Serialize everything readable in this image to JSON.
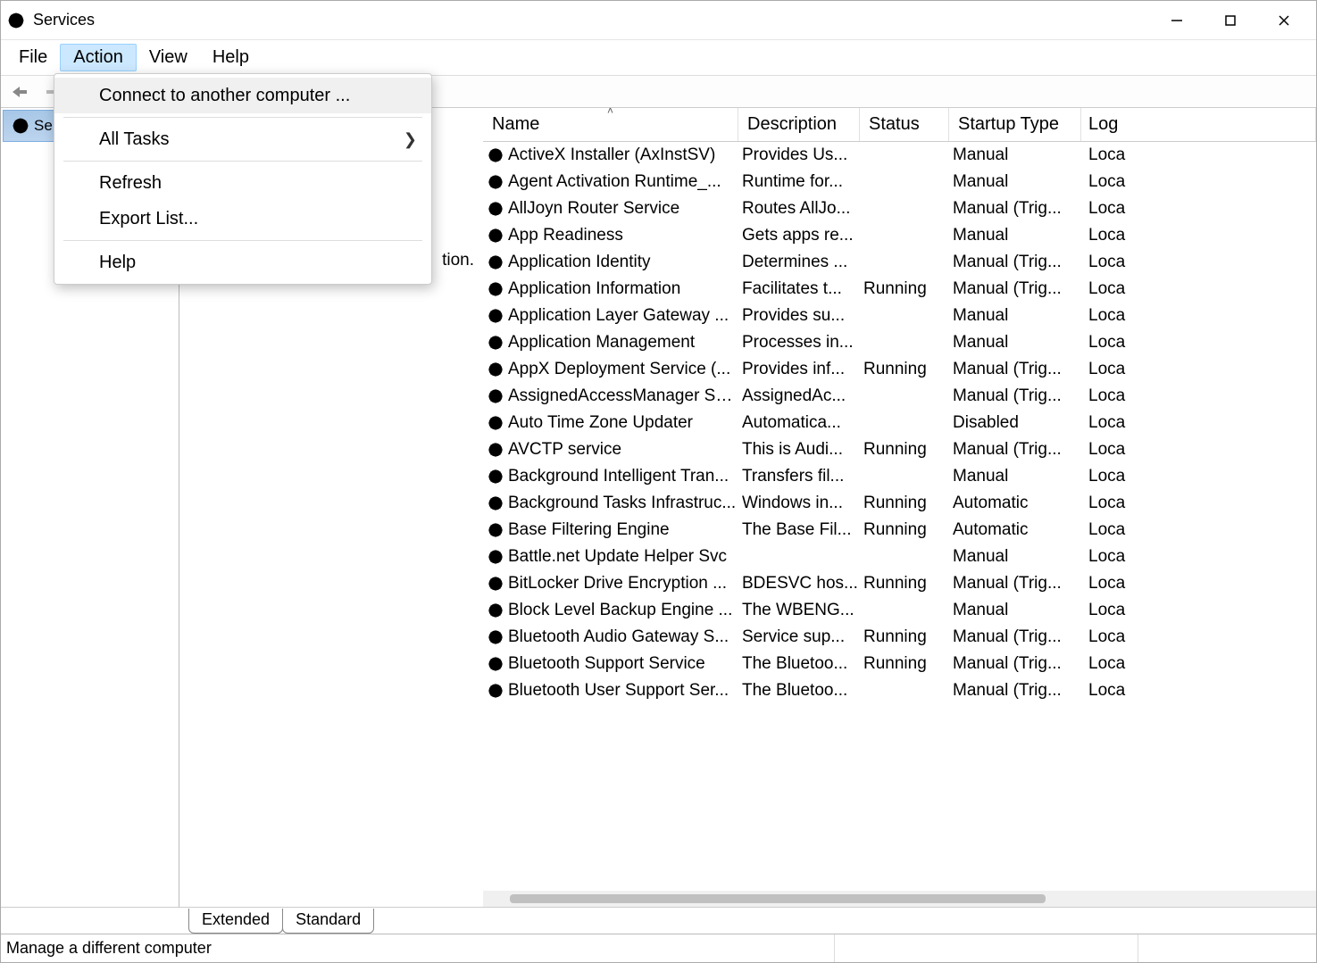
{
  "window": {
    "title": "Services"
  },
  "menubar": {
    "file": "File",
    "action": "Action",
    "view": "View",
    "help": "Help"
  },
  "dropdown": {
    "connect": "Connect to another computer ...",
    "all_tasks": "All Tasks",
    "refresh": "Refresh",
    "export_list": "Export List...",
    "help": "Help"
  },
  "tree": {
    "root_visible_fragment": "Se"
  },
  "detail": {
    "text_fragment": "tion."
  },
  "columns": {
    "name": "Name",
    "description": "Description",
    "status": "Status",
    "startup": "Startup Type",
    "logon": "Log"
  },
  "services": [
    {
      "name": "ActiveX Installer (AxInstSV)",
      "desc": "Provides Us...",
      "status": "",
      "startup": "Manual",
      "logon": "Loca"
    },
    {
      "name": "Agent Activation Runtime_...",
      "desc": "Runtime for...",
      "status": "",
      "startup": "Manual",
      "logon": "Loca"
    },
    {
      "name": "AllJoyn Router Service",
      "desc": "Routes AllJo...",
      "status": "",
      "startup": "Manual (Trig...",
      "logon": "Loca"
    },
    {
      "name": "App Readiness",
      "desc": "Gets apps re...",
      "status": "",
      "startup": "Manual",
      "logon": "Loca"
    },
    {
      "name": "Application Identity",
      "desc": "Determines ...",
      "status": "",
      "startup": "Manual (Trig...",
      "logon": "Loca"
    },
    {
      "name": "Application Information",
      "desc": "Facilitates t...",
      "status": "Running",
      "startup": "Manual (Trig...",
      "logon": "Loca"
    },
    {
      "name": "Application Layer Gateway ...",
      "desc": "Provides su...",
      "status": "",
      "startup": "Manual",
      "logon": "Loca"
    },
    {
      "name": "Application Management",
      "desc": "Processes in...",
      "status": "",
      "startup": "Manual",
      "logon": "Loca"
    },
    {
      "name": "AppX Deployment Service (...",
      "desc": "Provides inf...",
      "status": "Running",
      "startup": "Manual (Trig...",
      "logon": "Loca"
    },
    {
      "name": "AssignedAccessManager Se...",
      "desc": "AssignedAc...",
      "status": "",
      "startup": "Manual (Trig...",
      "logon": "Loca"
    },
    {
      "name": "Auto Time Zone Updater",
      "desc": "Automatica...",
      "status": "",
      "startup": "Disabled",
      "logon": "Loca"
    },
    {
      "name": "AVCTP service",
      "desc": "This is Audi...",
      "status": "Running",
      "startup": "Manual (Trig...",
      "logon": "Loca"
    },
    {
      "name": "Background Intelligent Tran...",
      "desc": "Transfers fil...",
      "status": "",
      "startup": "Manual",
      "logon": "Loca"
    },
    {
      "name": "Background Tasks Infrastruc...",
      "desc": "Windows in...",
      "status": "Running",
      "startup": "Automatic",
      "logon": "Loca"
    },
    {
      "name": "Base Filtering Engine",
      "desc": "The Base Fil...",
      "status": "Running",
      "startup": "Automatic",
      "logon": "Loca"
    },
    {
      "name": "Battle.net Update Helper Svc",
      "desc": "",
      "status": "",
      "startup": "Manual",
      "logon": "Loca"
    },
    {
      "name": "BitLocker Drive Encryption ...",
      "desc": "BDESVC hos...",
      "status": "Running",
      "startup": "Manual (Trig...",
      "logon": "Loca"
    },
    {
      "name": "Block Level Backup Engine ...",
      "desc": "The WBENG...",
      "status": "",
      "startup": "Manual",
      "logon": "Loca"
    },
    {
      "name": "Bluetooth Audio Gateway S...",
      "desc": "Service sup...",
      "status": "Running",
      "startup": "Manual (Trig...",
      "logon": "Loca"
    },
    {
      "name": "Bluetooth Support Service",
      "desc": "The Bluetoo...",
      "status": "Running",
      "startup": "Manual (Trig...",
      "logon": "Loca"
    },
    {
      "name": "Bluetooth User Support Ser...",
      "desc": "The Bluetoo...",
      "status": "",
      "startup": "Manual (Trig...",
      "logon": "Loca"
    }
  ],
  "tabs": {
    "extended": "Extended",
    "standard": "Standard"
  },
  "statusbar": "Manage a different computer",
  "icons": {
    "chevron_right": "❯",
    "sort_asc": "˄"
  }
}
